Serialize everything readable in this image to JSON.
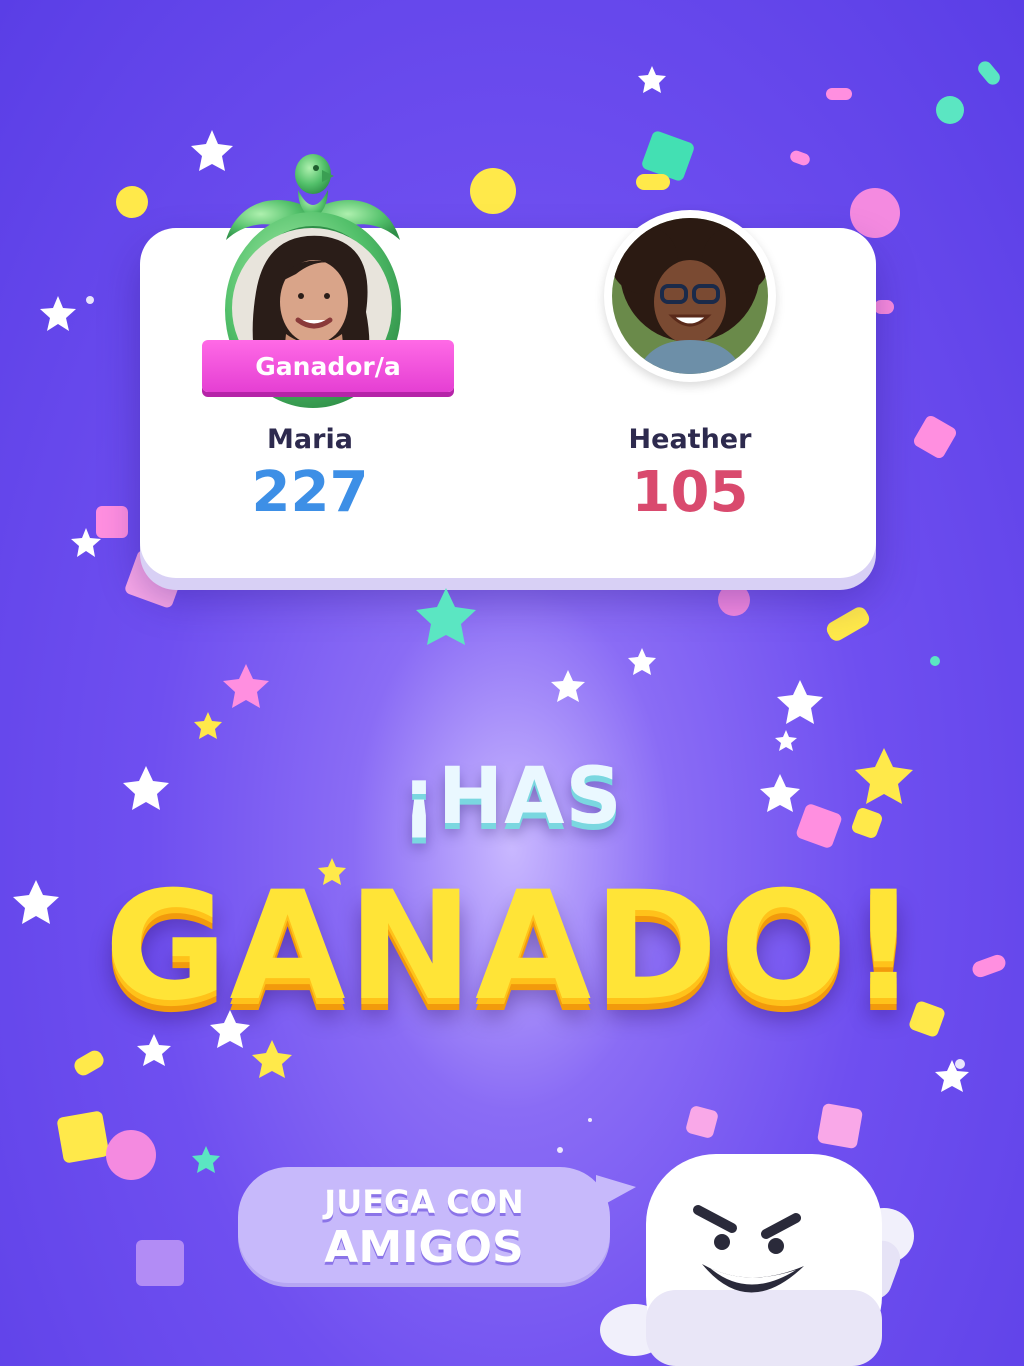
{
  "winner_badge": "Ganador/a",
  "players": [
    {
      "name": "Maria",
      "score": "227",
      "score_color": "#3d8fe6"
    },
    {
      "name": "Heather",
      "score": "105",
      "score_color": "#d94a6e"
    }
  ],
  "headline": {
    "line1": "¡HAS",
    "line2": "GANADO!"
  },
  "cta": {
    "line1": "JUEGA CON",
    "line2": "AMIGOS"
  },
  "colors": {
    "background": "#6f4ff0",
    "badge": "#e53fd3",
    "title_yellow": "#ffe437",
    "bubble": "#c7b9fb"
  },
  "icons": [
    "eagle-frame-icon",
    "star-icon",
    "mascot-icon"
  ]
}
